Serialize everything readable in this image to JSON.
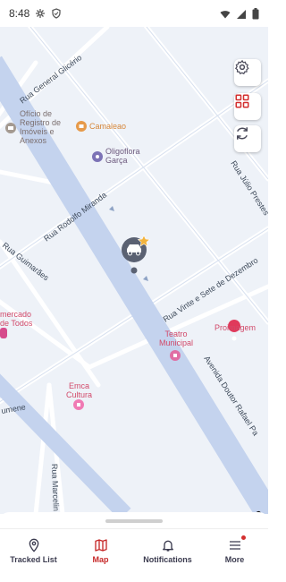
{
  "status_bar": {
    "time": "8:48",
    "icons": [
      "gear-icon",
      "shield-icon",
      "wifi-icon",
      "cellular-icon",
      "battery-icon"
    ]
  },
  "map": {
    "streets": {
      "rua_general_glicerio": "Rua General Glicério",
      "rua_rodolfo_miranda": "Rua Rodolfo Miranda",
      "rua_guimaraes": "Rua Guimarães",
      "rua_vinte_e_sete_de_dezembro": "Rua Vinte e Sete de Dezembro",
      "avenida_doutor_rafael_paes": "Avenida Doutor Rafael Pa",
      "rua_julio_prestes": "Rua Júlio Prestes",
      "rua_marcelino": "Rua Marcelin",
      "rumene": "umene"
    },
    "pois": {
      "oficio": [
        "Ofício de",
        "Registro de",
        "Imóveis e",
        "Anexos"
      ],
      "camaleao": "Camaleao",
      "oligoflora": [
        "Oligoflora",
        "Garça"
      ],
      "mercado": [
        "mercado",
        "de Todos"
      ],
      "teatro": [
        "Teatro",
        "Municipal"
      ],
      "proimagem": "Proimagem",
      "emca": [
        "Emca",
        "Cultura"
      ]
    },
    "controls": {
      "settings": "gear-icon",
      "focus": "qr-scan-icon",
      "refresh": "refresh-icon"
    },
    "logo": "here"
  },
  "bottom_nav": {
    "items": [
      {
        "label": "Tracked List",
        "icon": "location-pin-icon",
        "active": false
      },
      {
        "label": "Map",
        "icon": "map-icon",
        "active": true
      },
      {
        "label": "Notifications",
        "icon": "bell-icon",
        "active": false
      },
      {
        "label": "More",
        "icon": "menu-icon",
        "active": false,
        "badge": true
      }
    ]
  },
  "colors": {
    "accent": "#c62828",
    "road_main": "#c6d4ee",
    "road_secondary": "#ffffff",
    "map_bg": "#eef2f8"
  }
}
